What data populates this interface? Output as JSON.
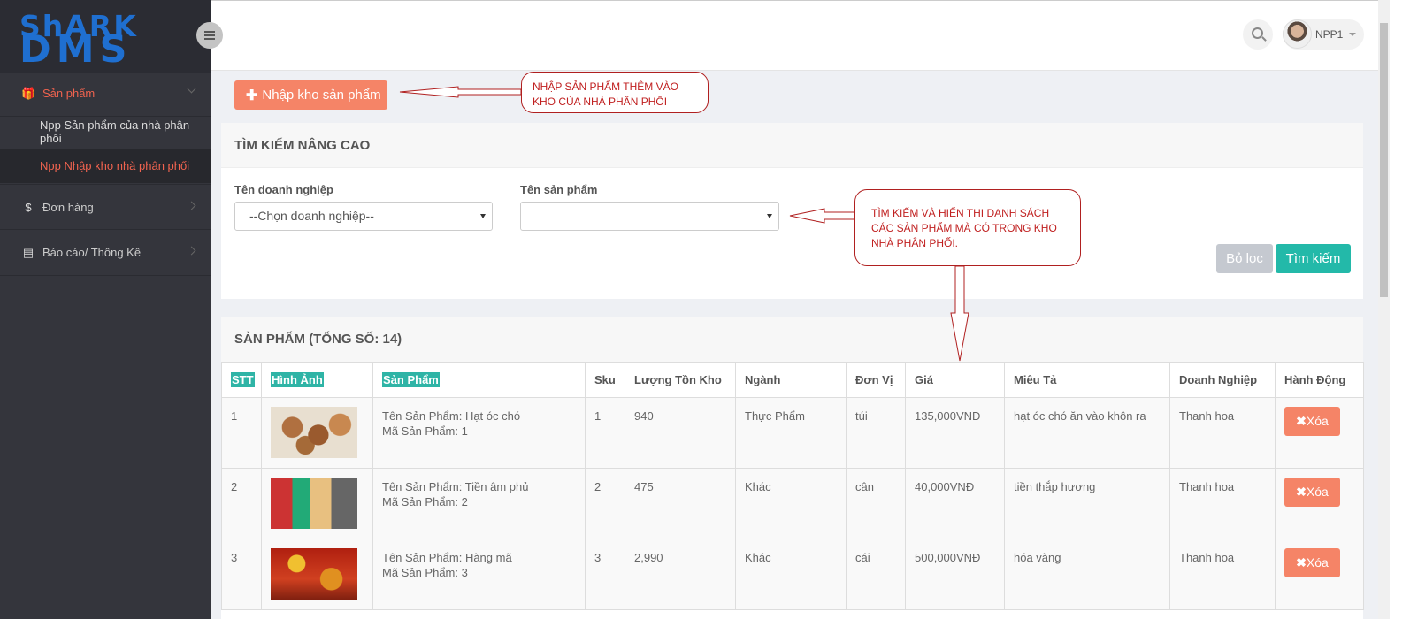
{
  "logo": {
    "line1": "ShARK",
    "line2": "DMS"
  },
  "sidebar": {
    "items": [
      {
        "label": "Sản phẩm",
        "icon": "gift-icon",
        "glyph": "🎁"
      },
      {
        "label": "Npp Sản phẩm của nhà phân phối"
      },
      {
        "label": "Npp Nhập kho nhà phân phối"
      },
      {
        "label": "Đơn hàng",
        "icon": "dollar-icon",
        "glyph": "$"
      },
      {
        "label": "Báo cáo/ Thống Kê",
        "icon": "report-icon",
        "glyph": "▤"
      }
    ]
  },
  "header": {
    "user": "NPP1"
  },
  "actions": {
    "add_label": "Nhập kho sản phẩm"
  },
  "search_panel": {
    "title": "TÌM KIẾM NÂNG CAO",
    "company_label": "Tên doanh nghiệp",
    "company_value": "--Chọn doanh nghiệp--",
    "product_label": "Tên sản phẩm",
    "product_value": "",
    "reset_label": "Bỏ lọc",
    "search_label": "Tìm kiếm"
  },
  "products_panel": {
    "title": "SẢN PHẨM (TỔNG SỐ: 14)",
    "columns": [
      "STT",
      "Hình Ảnh",
      "Sản Phẩm",
      "Sku",
      "Lượng Tồn Kho",
      "Ngành",
      "Đơn Vị",
      "Giá",
      "Miêu Tả",
      "Doanh Nghiệp",
      "Hành Động"
    ],
    "rows": [
      {
        "stt": "1",
        "name": "Tên Sản Phẩm: Hạt óc chó",
        "code": "Mã Sản Phẩm: 1",
        "sku": "1",
        "stock": "940",
        "category": "Thực Phẩm",
        "unit": "túi",
        "price": "135,000VNĐ",
        "desc": "hạt óc chó ăn vào khôn ra",
        "company": "Thanh hoa",
        "action": "Xóa"
      },
      {
        "stt": "2",
        "name": "Tên Sản Phẩm: Tiền âm phủ",
        "code": "Mã Sản Phẩm: 2",
        "sku": "2",
        "stock": "475",
        "category": "Khác",
        "unit": "cân",
        "price": "40,000VNĐ",
        "desc": "tiền thắp hương",
        "company": "Thanh hoa",
        "action": "Xóa"
      },
      {
        "stt": "3",
        "name": "Tên Sản Phẩm: Hàng mã",
        "code": "Mã Sản Phẩm: 3",
        "sku": "3",
        "stock": "2,990",
        "category": "Khác",
        "unit": "cái",
        "price": "500,000VNĐ",
        "desc": "hóa vàng",
        "company": "Thanh hoa",
        "action": "Xóa"
      }
    ]
  },
  "annotations": {
    "callout1_line1": "NHẬP SẢN PHẨM THÊM VÀO",
    "callout1_line2": "KHO CỦA NHÀ PHÂN PHỐI",
    "callout2_line1": "TÌM KIẾM VÀ HIỂN THỊ DANH SÁCH",
    "callout2_line2": "CÁC SẢN PHẨM MÀ CÓ TRONG KHO",
    "callout2_line3": "NHÀ PHÂN PHỐI."
  },
  "colors": {
    "accent": "#f58467",
    "teal": "#23b9a9",
    "sidebar": "#34353c",
    "active": "#f0634f"
  }
}
